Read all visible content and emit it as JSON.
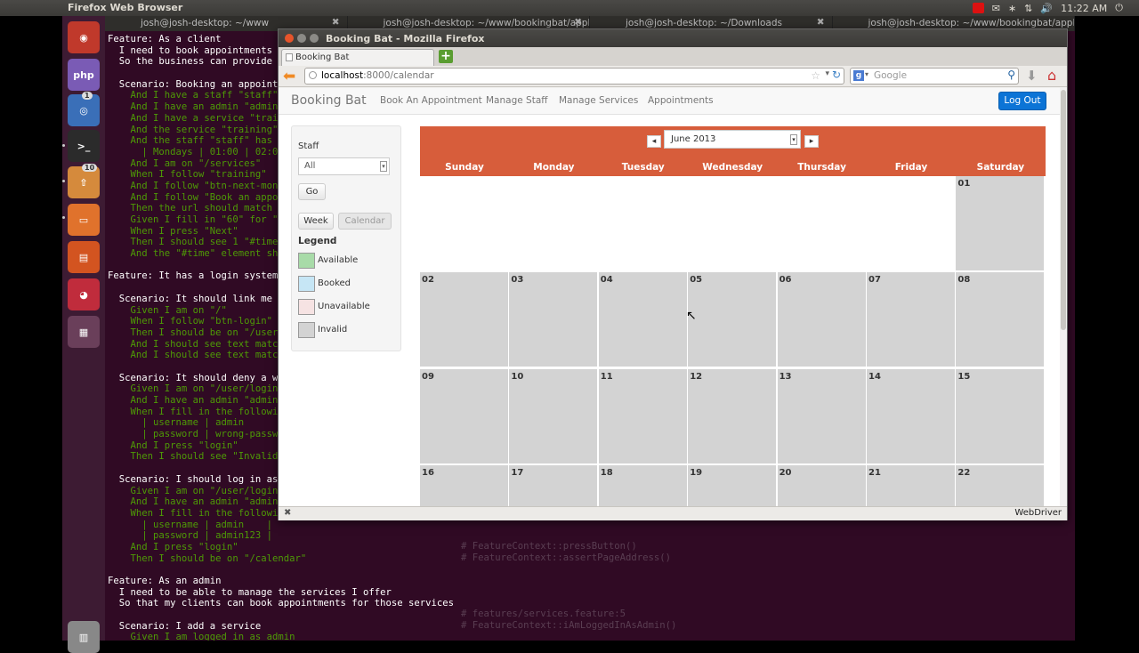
{
  "top_panel": {
    "app_title": "Firefox Web Browser",
    "tray": [
      "✉",
      "∗",
      "⇅",
      "🔊",
      "⏻"
    ],
    "clock": "11:22 AM"
  },
  "launcher": {
    "items": [
      {
        "name": "ubuntu-icon",
        "label": "◉",
        "color": "#c0392b"
      },
      {
        "name": "phpstorm-icon",
        "label": "php",
        "color": "#7a5bb5"
      },
      {
        "name": "chromium-icon",
        "label": "◎",
        "color": "#3a6fb8",
        "badge": "1"
      },
      {
        "name": "terminal-icon",
        "label": ">_",
        "color": "#2b2b2b"
      },
      {
        "name": "update-manager-icon",
        "label": "⇧",
        "color": "#d58a3c",
        "badge": "10"
      },
      {
        "name": "files-icon",
        "label": "▭",
        "color": "#e0722c"
      },
      {
        "name": "software-center-icon",
        "label": "▤",
        "color": "#d35420"
      },
      {
        "name": "app-icon",
        "label": "◕",
        "color": "#c02c3c"
      },
      {
        "name": "workspace-switcher-icon",
        "label": "▦",
        "color": "#6a3f5a"
      },
      {
        "name": "trash-icon",
        "label": "▥",
        "color": "#888"
      }
    ]
  },
  "terminal": {
    "tabs": [
      "josh@josh-desktop: ~/www",
      "josh@josh-desktop: ~/www/bookingbat/application",
      "josh@josh-desktop: ~/Downloads",
      "josh@josh-desktop: ~/www/bookingbat/applicati"
    ],
    "lines": [
      {
        "t": "Feature: As a client",
        "c": ""
      },
      {
        "t": "  I need to book appointments",
        "c": ""
      },
      {
        "t": "  So the business can provide",
        "c": ""
      },
      {
        "t": "",
        "c": ""
      },
      {
        "t": "  Scenario: Booking an appoint",
        "c": ""
      },
      {
        "t": "    And I have a staff \"staff\"",
        "c": "g"
      },
      {
        "t": "    And I have an admin \"admin",
        "c": "g"
      },
      {
        "t": "    And I have a service \"trai",
        "c": "g"
      },
      {
        "t": "    And the service \"training\"",
        "c": "g"
      },
      {
        "t": "    And the staff \"staff\" has",
        "c": "g"
      },
      {
        "t": "      | Mondays | 01:00 | 02:0",
        "c": "g"
      },
      {
        "t": "    And I am on \"/services\"",
        "c": "g"
      },
      {
        "t": "    When I follow \"training\"",
        "c": "g"
      },
      {
        "t": "    And I follow \"btn-next-mont",
        "c": "g"
      },
      {
        "t": "    And I follow \"Book an appo",
        "c": "g"
      },
      {
        "t": "    Then the url should match",
        "c": "g"
      },
      {
        "t": "    Given I fill in \"60\" for \"",
        "c": "g"
      },
      {
        "t": "    When I press \"Next\"",
        "c": "g"
      },
      {
        "t": "    Then I should see 1 \"#time",
        "c": "g"
      },
      {
        "t": "    And the \"#time\" element sh",
        "c": "g"
      },
      {
        "t": "",
        "c": ""
      },
      {
        "t": "Feature: It has a login system",
        "c": ""
      },
      {
        "t": "",
        "c": ""
      },
      {
        "t": "  Scenario: It should link me",
        "c": ""
      },
      {
        "t": "    Given I am on \"/\"",
        "c": "g"
      },
      {
        "t": "    When I follow \"btn-login\"",
        "c": "g"
      },
      {
        "t": "    Then I should be on \"/user",
        "c": "g"
      },
      {
        "t": "    And I should see text matc",
        "c": "g"
      },
      {
        "t": "    And I should see text matc",
        "c": "g"
      },
      {
        "t": "",
        "c": ""
      },
      {
        "t": "  Scenario: It should deny a w",
        "c": ""
      },
      {
        "t": "    Given I am on \"/user/login",
        "c": "g"
      },
      {
        "t": "    And I have an admin \"admin",
        "c": "g"
      },
      {
        "t": "    When I fill in the followi",
        "c": "g"
      },
      {
        "t": "      | username | admin",
        "c": "g"
      },
      {
        "t": "      | password | wrong-passw",
        "c": "g"
      },
      {
        "t": "    And I press \"login\"",
        "c": "g"
      },
      {
        "t": "    Then I should see \"Invalid",
        "c": "g"
      },
      {
        "t": "",
        "c": ""
      },
      {
        "t": "  Scenario: I should log in as",
        "c": ""
      },
      {
        "t": "    Given I am on \"/user/login",
        "c": "g"
      },
      {
        "t": "    And I have an admin \"admin",
        "c": "g"
      },
      {
        "t": "    When I fill in the followi",
        "c": "g"
      },
      {
        "t": "      | username | admin    |",
        "c": "g"
      },
      {
        "t": "      | password | admin123 |",
        "c": "g"
      },
      {
        "t": "    And I press \"login\"",
        "c": "g"
      },
      {
        "t": "    Then I should be on \"/calendar\"",
        "c": "g"
      },
      {
        "t": "",
        "c": ""
      },
      {
        "t": "Feature: As an admin",
        "c": ""
      },
      {
        "t": "  I need to be able to manage the services I offer",
        "c": ""
      },
      {
        "t": "  So that my clients can book appointments for those services",
        "c": ""
      },
      {
        "t": "",
        "c": ""
      },
      {
        "t": "  Scenario: I add a service",
        "c": ""
      },
      {
        "t": "    Given I am logged in as admin",
        "c": "g"
      }
    ],
    "right_lines": [
      "# FeatureContext::pressButton()",
      "# FeatureContext::assertPageAddress()",
      "",
      "",
      "",
      "",
      "# features/services.feature:5",
      "# FeatureContext::iAmLoggedInAsAdmin()"
    ]
  },
  "firefox": {
    "title": "Booking Bat - Mozilla Firefox",
    "tab_label": "Booking Bat",
    "url_host": "localhost",
    "url_path": ":8000/calendar",
    "search_placeholder": "Google",
    "status_right": "WebDriver"
  },
  "page": {
    "brand": "Booking Bat",
    "nav": [
      "Book An Appointment",
      "Manage Staff",
      "Manage Services",
      "Appointments"
    ],
    "logout": "Log Out",
    "sidebar": {
      "staff_label": "Staff",
      "staff_value": "All",
      "go": "Go",
      "week": "Week",
      "calendar": "Calendar",
      "legend_title": "Legend",
      "legend": [
        {
          "label": "Available",
          "color": "#a8dba8"
        },
        {
          "label": "Booked",
          "color": "#c6e6f5"
        },
        {
          "label": "Unavailable",
          "color": "#f6e3e3"
        },
        {
          "label": "Invalid",
          "color": "#d3d3d3"
        }
      ]
    },
    "calendar": {
      "month": "June 2013",
      "prev": "◂",
      "next": "▸",
      "days": [
        "Sunday",
        "Monday",
        "Tuesday",
        "Wednesday",
        "Thursday",
        "Friday",
        "Saturday"
      ],
      "header_color": "#d75d3b",
      "weeks": [
        [
          "",
          "",
          "",
          "",
          "",
          "",
          "01"
        ],
        [
          "02",
          "03",
          "04",
          "05",
          "06",
          "07",
          "08"
        ],
        [
          "09",
          "10",
          "11",
          "12",
          "13",
          "14",
          "15"
        ],
        [
          "16",
          "17",
          "18",
          "19",
          "20",
          "21",
          "22"
        ]
      ]
    }
  }
}
